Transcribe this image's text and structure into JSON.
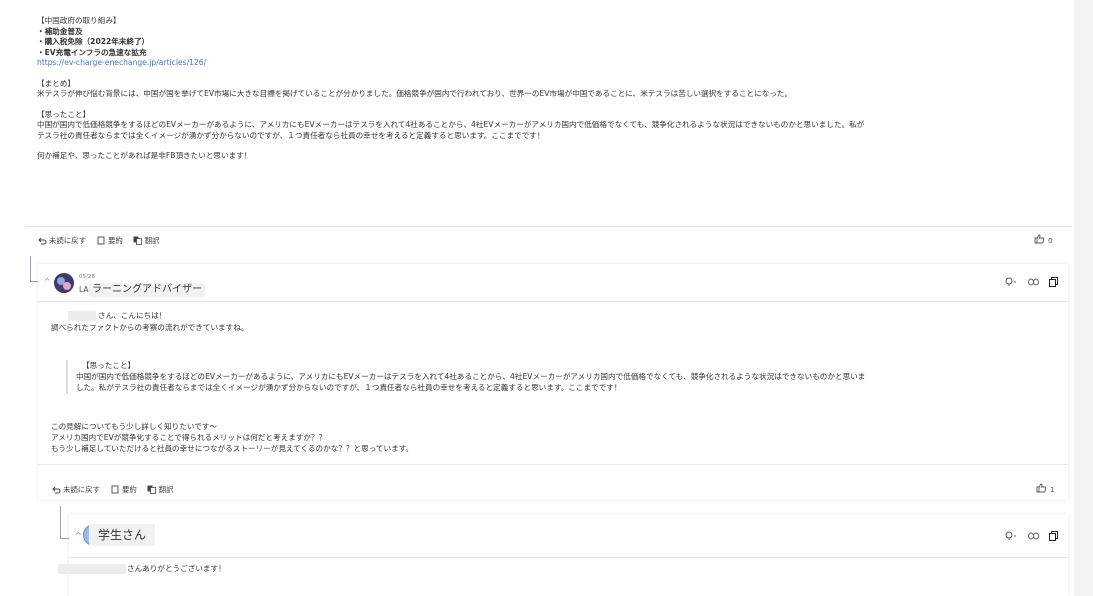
{
  "top_post": {
    "lines": [
      {
        "text": "【中国政府の取り組み】",
        "bold": false
      },
      {
        "text": "・補助金普及",
        "bold": true
      },
      {
        "text": "・購入税免除（2022年末終了）",
        "bold": true
      },
      {
        "text": "・EV充電インフラの急速な拡充",
        "bold": true
      }
    ],
    "link": "https://ev-charge-enechange.jp/articles/126/",
    "summary_heading": "【まとめ】",
    "summary_text": "米テスラが伸び悩む背景には、中国が国を挙げてEV市場に大きな目標を掲げていることが分かりました。価格競争が国内で行われており、世界一のEV市場が中国であることに、米テスラは苦しい選択をすることになった。",
    "thought_heading": "【思ったこと】",
    "thought_line1": "中国が国内で低価格競争をするほどのEVメーカーがあるように、アメリカにもEVメーカーはテスラを入れて4社あることから、4社EVメーカーがアメリカ国内で低価格でなくても、競争化されるような状況はできないものかと思いました。私が",
    "thought_line2": "テスラ社の責任者ならまでは全くイメージが湧かず分からないのですが、１つ責任者なら社員の幸せを考えると定義すると思います。ここまでです！",
    "closing": "何か補足や、思ったことがあれば是非FB頂きたいと思います！",
    "actions": {
      "unread": "未読に戻す",
      "summary": "要約",
      "translate": "翻訳"
    },
    "like_count": "0"
  },
  "reply1": {
    "date": "05/28",
    "role": "LA",
    "author": "ラーニングアドバイザー",
    "greeting": "さん、こんにちは！",
    "line2": "調べられたファクトからの考察の流れができていますね。",
    "quote_heading": "【思ったこと】",
    "quote_line1": "中国が国内で低価格競争をするほどのEVメーカーがあるように、アメリカにもEVメーカーはテスラを入れて4社あることから、4社EVメーカーがアメリカ国内で低価格でなくても、競争化されるような状況はできないものかと思いま",
    "quote_line2": "した。私がテスラ社の責任者ならまでは全くイメージが湧かず分からないのですが、１つ責任者なら社員の幸せを考えると定義すると思います。ここまでです！",
    "body1": "この見解についてもう少し詳しく知りたいです〜",
    "body2": "アメリカ国内でEVが競争化することで得られるメリットは何だと考えますか？？",
    "body3": "もう少し補足していただけると社員の幸せにつながるストーリーが見えてくるのかな？？と思っています。",
    "actions": {
      "unread": "未読に戻す",
      "summary": "要約",
      "translate": "翻訳"
    },
    "like_count": "1"
  },
  "reply2": {
    "author": "学生さん",
    "text": "さんありがとうございます！"
  },
  "icons": {
    "unread": "undo-icon",
    "summary": "document-icon",
    "translate": "translate-icon",
    "like": "thumbs-up-icon",
    "pin": "lightbulb-icon",
    "link": "link-icon",
    "copy": "copy-icon"
  },
  "colors": {
    "link": "#3a7bd5",
    "avatar_student": "#9bb8f2"
  }
}
